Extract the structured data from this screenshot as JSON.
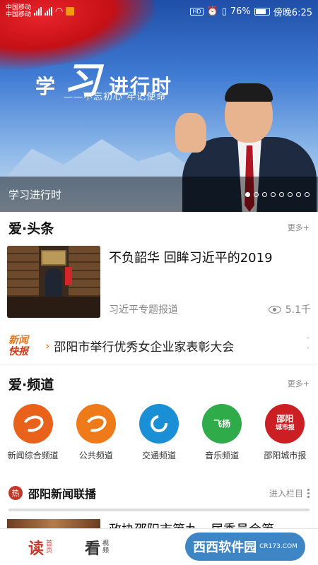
{
  "status_bar": {
    "carrier_1": "中国移动",
    "carrier_2": "中国移动",
    "hd": "HD",
    "battery": "76%",
    "time": "傍晚6:25"
  },
  "banner": {
    "slogan_left": "学",
    "slogan_mark": "习",
    "slogan_right": "进行时",
    "slogan_sub": "——不忘初心 牢记使命",
    "caption": "学习进行时",
    "slide_count": 8,
    "active_slide": 1
  },
  "headlines": {
    "title": "爱·头条",
    "more": "更多+",
    "card": {
      "title": "不负韶华 回眸习近平的2019",
      "source": "习近平专题报道",
      "views": "5.1千"
    }
  },
  "ticker": {
    "logo_line1": "新闻",
    "logo_line2": "快报",
    "text": "邵阳市举行优秀女企业家表彰大会"
  },
  "channels_section": {
    "title": "爱·频道",
    "more": "更多+",
    "items": [
      {
        "label": "新闻综合频道",
        "color": "#e8621c"
      },
      {
        "label": "公共频道",
        "color": "#ef7a1a"
      },
      {
        "label": "交通频道",
        "color": "#1b8fd6"
      },
      {
        "label": "音乐频道",
        "color": "#2fab4a",
        "icon_text": "飞扬"
      },
      {
        "label": "邵阳城市报",
        "color": "#cc1f24",
        "icon_text": "邵阳",
        "icon_text2": "城市报"
      }
    ]
  },
  "hot": {
    "badge": "热",
    "title": "邵阳新闻联播",
    "more": "进入栏目",
    "peek_title": "政协邵阳市第九一届委员会第"
  },
  "bottom_nav": {
    "read_main": "读",
    "read_sub1": "首",
    "read_sub2": "页",
    "watch_main": "看",
    "watch_sub1": "视",
    "watch_sub2": "频"
  },
  "watermark": {
    "brand": "西西软件园",
    "url": "CR173.COM"
  }
}
